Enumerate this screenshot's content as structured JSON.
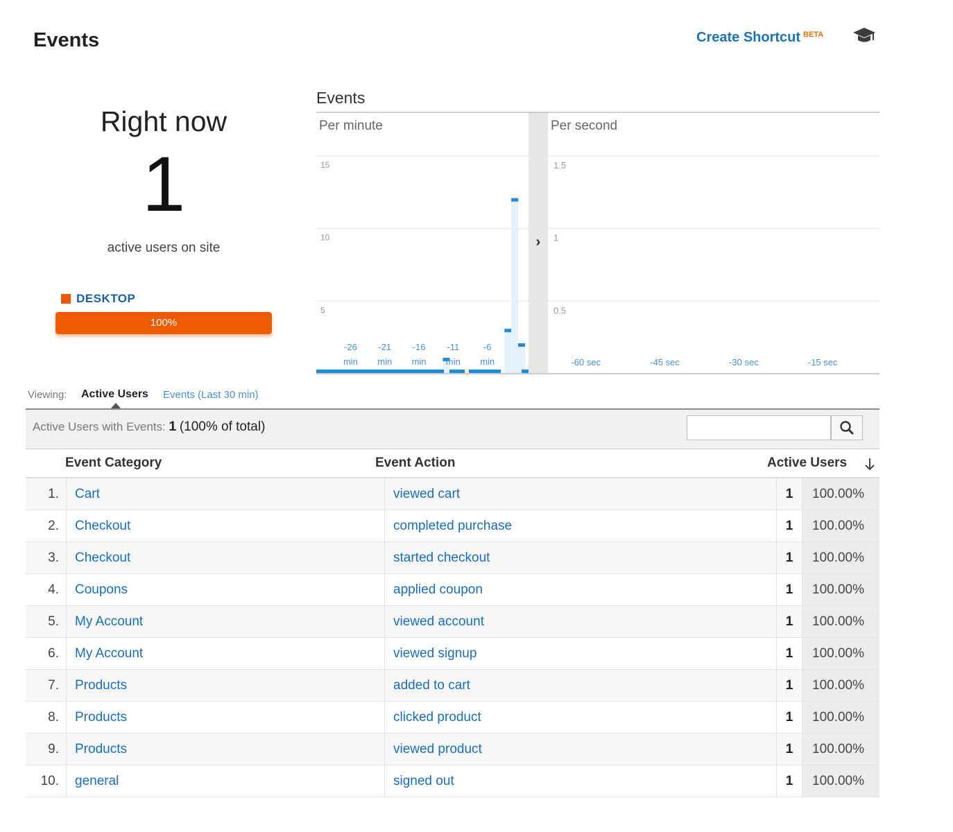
{
  "header": {
    "title": "Events",
    "create_shortcut": "Create Shortcut",
    "beta_badge": "BETA",
    "help_icon": "graduation-cap-icon"
  },
  "right_now": {
    "title": "Right now",
    "count": "1",
    "subtitle": "active users on site",
    "device_label": "DESKTOP",
    "device_percent_label": "100%",
    "device_share": 100,
    "device_color": "#ed5a00"
  },
  "chart_data": [
    {
      "type": "bar",
      "title": "Events",
      "panel": "Per minute",
      "ylim": [
        0,
        17
      ],
      "yticks": [
        5,
        10,
        15
      ],
      "x_tick_labels": [
        "-26 min",
        "-21 min",
        "-16 min",
        "-11 min",
        "-6 min"
      ],
      "x_tick_minutes": [
        -26,
        -21,
        -16,
        -11,
        -6
      ],
      "x_range_minutes": [
        -30,
        -1
      ],
      "values_by_minute": [
        {
          "minute": -3,
          "value": 3
        },
        {
          "minute": -2,
          "value": 12
        },
        {
          "minute": -1,
          "value": 2
        },
        {
          "minute": -12,
          "value": 1
        }
      ],
      "color": "#1f8dd6",
      "grid": true
    },
    {
      "type": "bar",
      "panel": "Per second",
      "ylim": [
        0,
        1.7
      ],
      "yticks": [
        0.5,
        1,
        1.5
      ],
      "ytick_labels": [
        "0.5",
        "1",
        "1.5"
      ],
      "x_tick_labels": [
        "-60 sec",
        "-45 sec",
        "-30 sec",
        "-15 sec"
      ],
      "x_tick_seconds": [
        -60,
        -45,
        -30,
        -15
      ],
      "x_range_seconds": [
        -63,
        0
      ],
      "values": [],
      "grid": true
    }
  ],
  "chart_ui": {
    "expand_label": "›"
  },
  "viewing": {
    "label": "Viewing:",
    "active": "Active Users",
    "other": "Events (Last 30 min)"
  },
  "summary": {
    "label": "Active Users with Events:",
    "value": "1",
    "percent": "(100% of total)",
    "search_placeholder": ""
  },
  "table": {
    "columns": [
      "Event Category",
      "Event Action",
      "Active Users"
    ],
    "rows": [
      {
        "idx": "1.",
        "category": "Cart",
        "action": "viewed cart",
        "users": "1",
        "pct": "100.00%"
      },
      {
        "idx": "2.",
        "category": "Checkout",
        "action": "completed purchase",
        "users": "1",
        "pct": "100.00%"
      },
      {
        "idx": "3.",
        "category": "Checkout",
        "action": "started checkout",
        "users": "1",
        "pct": "100.00%"
      },
      {
        "idx": "4.",
        "category": "Coupons",
        "action": "applied coupon",
        "users": "1",
        "pct": "100.00%"
      },
      {
        "idx": "5.",
        "category": "My Account",
        "action": "viewed account",
        "users": "1",
        "pct": "100.00%"
      },
      {
        "idx": "6.",
        "category": "My Account",
        "action": "viewed signup",
        "users": "1",
        "pct": "100.00%"
      },
      {
        "idx": "7.",
        "category": "Products",
        "action": "added to cart",
        "users": "1",
        "pct": "100.00%"
      },
      {
        "idx": "8.",
        "category": "Products",
        "action": "clicked product",
        "users": "1",
        "pct": "100.00%"
      },
      {
        "idx": "9.",
        "category": "Products",
        "action": "viewed product",
        "users": "1",
        "pct": "100.00%"
      },
      {
        "idx": "10.",
        "category": "general",
        "action": "signed out",
        "users": "1",
        "pct": "100.00%"
      }
    ]
  }
}
